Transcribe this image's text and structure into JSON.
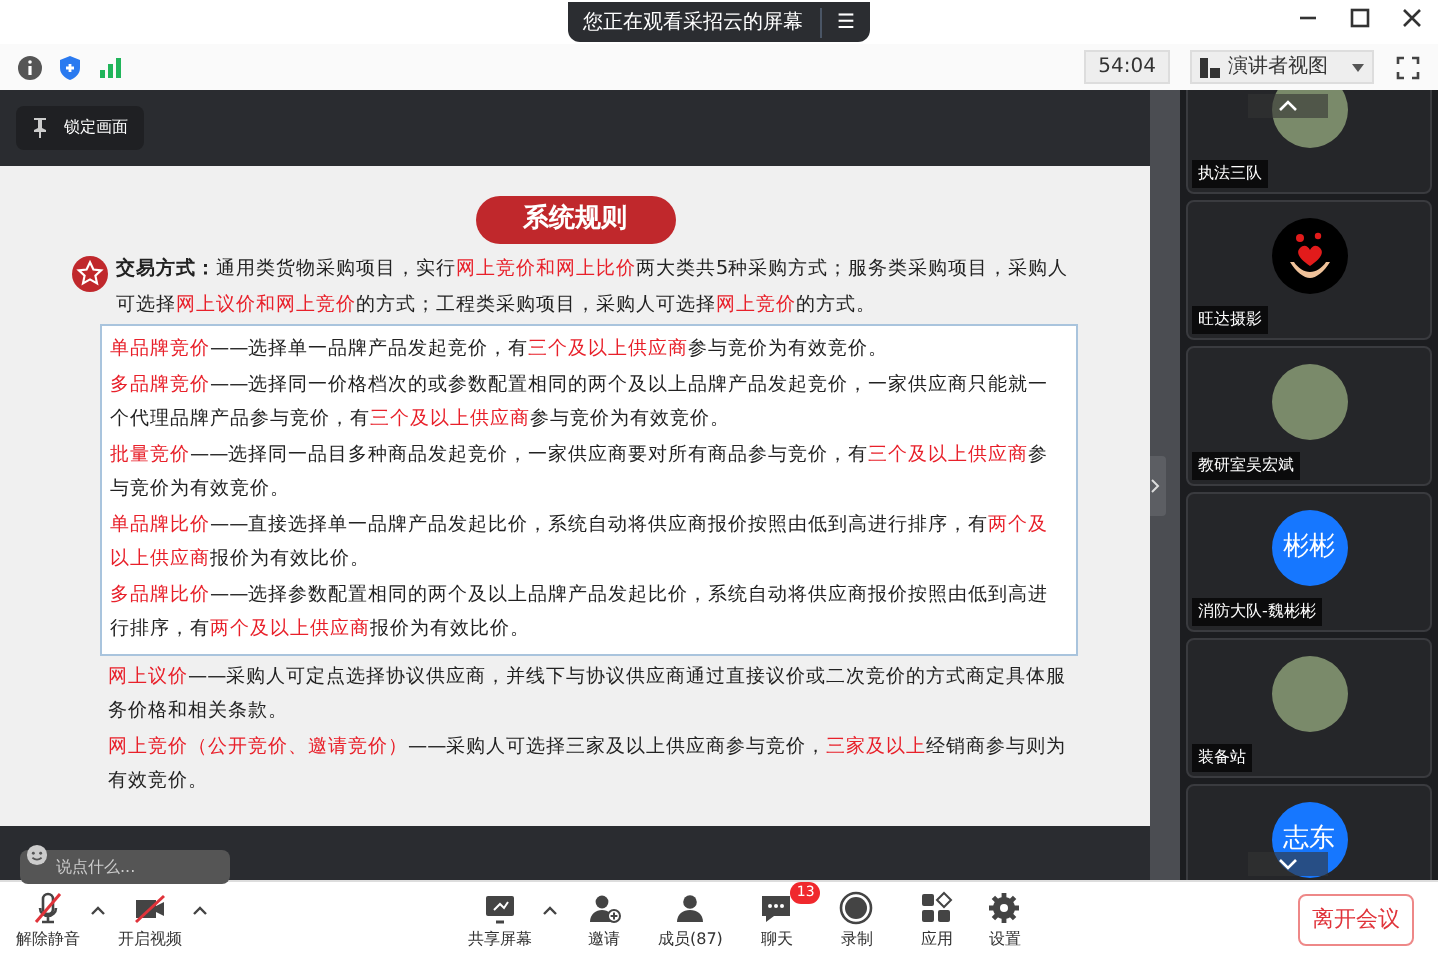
{
  "banner": {
    "title": "您正在观看采招云的屏幕",
    "menu_glyph": "☰"
  },
  "toolbar": {
    "timer": "54:04",
    "view_button": "演讲者视图"
  },
  "lock_button": "锁定画面",
  "slide": {
    "title": "系统规则",
    "intro": [
      {
        "text": "交易方式：",
        "highlight": false,
        "bold": true
      },
      {
        "text": "通用类货物采购项目，实行",
        "highlight": false
      },
      {
        "text": "网上竞价和网上比价",
        "highlight": true
      },
      {
        "text": "两大类共5种采购方式；服务类采购项目，采购人可选择",
        "highlight": false
      },
      {
        "text": "网上议价和网上竞价",
        "highlight": true
      },
      {
        "text": "的方式；工程类采购项目，采购人可选择",
        "highlight": false
      },
      {
        "text": "网上竞价",
        "highlight": true
      },
      {
        "text": "的方式。",
        "highlight": false
      }
    ],
    "boxed": [
      [
        {
          "text": "单品牌竞价",
          "highlight": true
        },
        {
          "text": "——选择单一品牌产品发起竞价，有",
          "highlight": false
        },
        {
          "text": "三个及以上供应商",
          "highlight": true
        },
        {
          "text": "参与竞价为有效竞价。",
          "highlight": false
        }
      ],
      [
        {
          "text": "多品牌竞价",
          "highlight": true
        },
        {
          "text": "——选择同一价格档次的或参数配置相同的两个及以上品牌产品发起竞价，一家供应商只能就一个代理品牌产品参与竞价，有",
          "highlight": false
        },
        {
          "text": "三个及以上供应商",
          "highlight": true
        },
        {
          "text": "参与竞价为有效竞价。",
          "highlight": false
        }
      ],
      [
        {
          "text": "批量竞价",
          "highlight": true
        },
        {
          "text": "——选择同一品目多种商品发起竞价，一家供应商要对所有商品参与竞价，有",
          "highlight": false
        },
        {
          "text": "三个及以上供应商",
          "highlight": true
        },
        {
          "text": "参与竞价为有效竞价。",
          "highlight": false
        }
      ],
      [
        {
          "text": "单品牌比价",
          "highlight": true
        },
        {
          "text": "——直接选择单一品牌产品发起比价，系统自动将供应商报价按照由低到高进行排序，有",
          "highlight": false
        },
        {
          "text": "两个及以上供应商",
          "highlight": true
        },
        {
          "text": "报价为有效比价。",
          "highlight": false
        }
      ],
      [
        {
          "text": "多品牌比价",
          "highlight": true
        },
        {
          "text": "——选择参数配置相同的两个及以上品牌产品发起比价，系统自动将供应商报价按照由低到高进行排序，有",
          "highlight": false
        },
        {
          "text": "两个及以上供应商",
          "highlight": true
        },
        {
          "text": "报价为有效比价。",
          "highlight": false
        }
      ]
    ],
    "after": [
      [
        {
          "text": "网上议价",
          "highlight": true
        },
        {
          "text": "——采购人可定点选择协议供应商，并线下与协议供应商通过直接议价或二次竞价的方式商定具体服务价格和相关条款。",
          "highlight": false
        }
      ],
      [
        {
          "text": "网上竞价（公开竞价、邀请竞价）",
          "highlight": true
        },
        {
          "text": "——采购人可选择三家及以上供应商参与竞价，",
          "highlight": false
        },
        {
          "text": "三家及以上",
          "highlight": true
        },
        {
          "text": "经销商参与则为有效竞价。",
          "highlight": false
        }
      ]
    ]
  },
  "chat_input": {
    "placeholder": "说点什么..."
  },
  "participants": [
    {
      "name": "执法三队",
      "kind": "photo"
    },
    {
      "name": "旺达摄影",
      "kind": "hearts"
    },
    {
      "name": "教研室吴宏斌",
      "kind": "photo"
    },
    {
      "name": "消防大队-魏彬彬",
      "kind": "text",
      "avatar_text": "彬彬"
    },
    {
      "name": "装备站",
      "kind": "photo"
    },
    {
      "kind": "text",
      "avatar_text": "志东"
    }
  ],
  "bottom_bar": [
    {
      "label": "解除静音",
      "kind": "mic",
      "caret": true
    },
    {
      "label": "开启视频",
      "kind": "video",
      "caret": true
    },
    {
      "label": "共享屏幕",
      "kind": "share",
      "caret": true
    },
    {
      "label": "邀请",
      "kind": "invite",
      "caret": false
    },
    {
      "label": "成员(87)",
      "kind": "members",
      "caret": false
    },
    {
      "label": "聊天",
      "kind": "chat",
      "caret": false,
      "badge": "13"
    },
    {
      "label": "录制",
      "kind": "record",
      "caret": false
    },
    {
      "label": "应用",
      "kind": "apps",
      "caret": false
    },
    {
      "label": "设置",
      "kind": "settings",
      "caret": false
    }
  ],
  "leave_button": "离开会议"
}
